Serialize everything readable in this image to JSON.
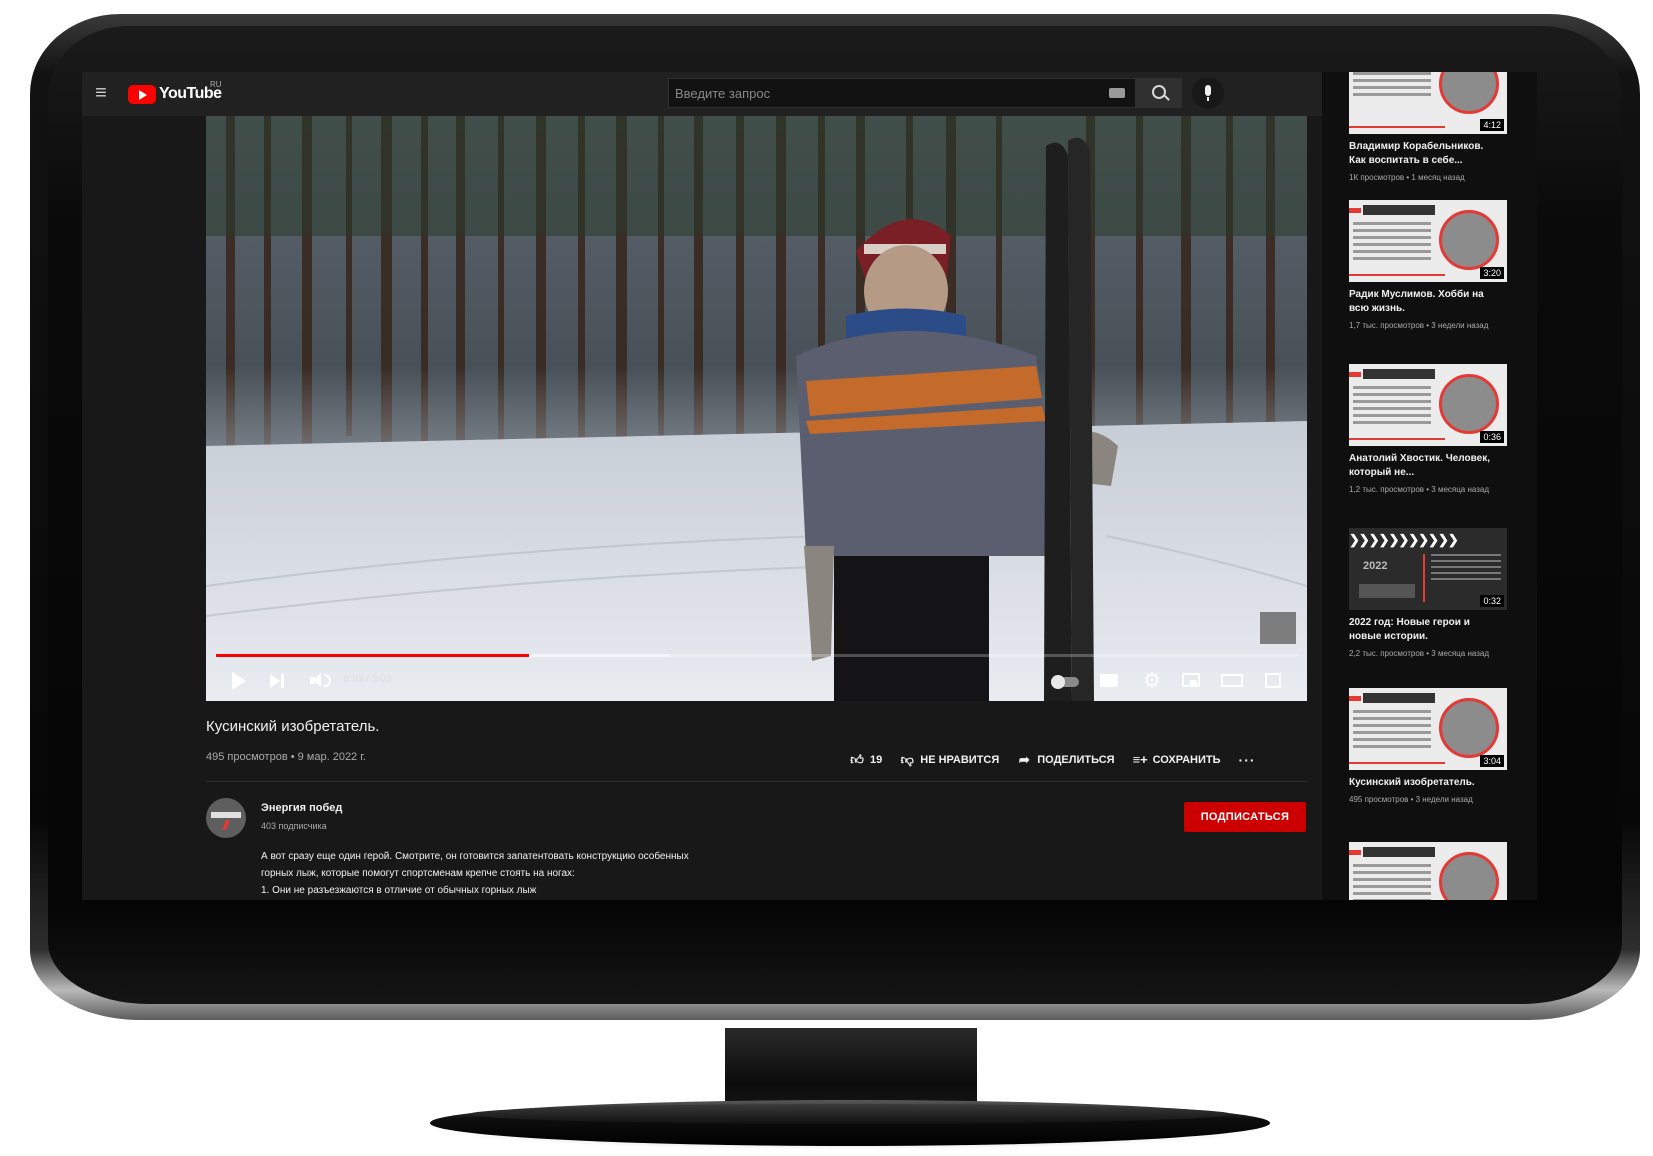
{
  "masthead": {
    "logo_text": "YouTube",
    "region": "RU",
    "search_placeholder": "Введите запрос"
  },
  "player": {
    "current_time": "0:53",
    "duration": "3:03",
    "time_display": "0:53 / 3:03",
    "progress_fraction": 0.29,
    "buffer_fraction": 0.42
  },
  "video": {
    "title": "Кусинский изобретатель.",
    "meta": "495 просмотров • 9 мар. 2022 г.",
    "likes": "19",
    "dislike_label": "НЕ НРАВИТСЯ",
    "share_label": "ПОДЕЛИТЬСЯ",
    "save_label": "СОХРАНИТЬ"
  },
  "channel": {
    "name": "Энергия побед",
    "subscribers": "403 подписчика",
    "subscribe_label": "ПОДПИСАТЬСЯ"
  },
  "description": [
    "А вот  сразу еще один герой. Смотрите, он готовится запатентовать конструкцию особенных",
    "горных лыж, которые помогут спортсменам крепче стоять на ногах:",
    "1. Они не разъезжаются в отличие от обычных горных лыж"
  ],
  "recommendations": [
    {
      "title": "Владимир Корабельников. Как воспитать в себе...",
      "meta": "1К просмотров • 1 месяц назад",
      "duration": "4:12"
    },
    {
      "title": "Радик Муслимов. Хобби на всю жизнь.",
      "meta": "1,7 тыс. просмотров • 3 недели назад",
      "duration": "3:20"
    },
    {
      "title": "Анатолий Хвостик. Человек, который не...",
      "meta": "1,2 тыс. просмотров • 3 месяца назад",
      "duration": "0:36"
    },
    {
      "title": "2022 год: Новые герои и новые истории.",
      "meta": "2,2 тыс. просмотров • 3 месяца назад",
      "duration": "0:32"
    },
    {
      "title": "Кусинский изобретатель.",
      "meta": "495 просмотров • 3 недели назад",
      "duration": "3:04"
    },
    {
      "title": "",
      "meta": "",
      "duration": ""
    }
  ],
  "colors": {
    "accent": "#ff0000",
    "subscribe": "#cc0000",
    "page_bg": "#181818"
  }
}
